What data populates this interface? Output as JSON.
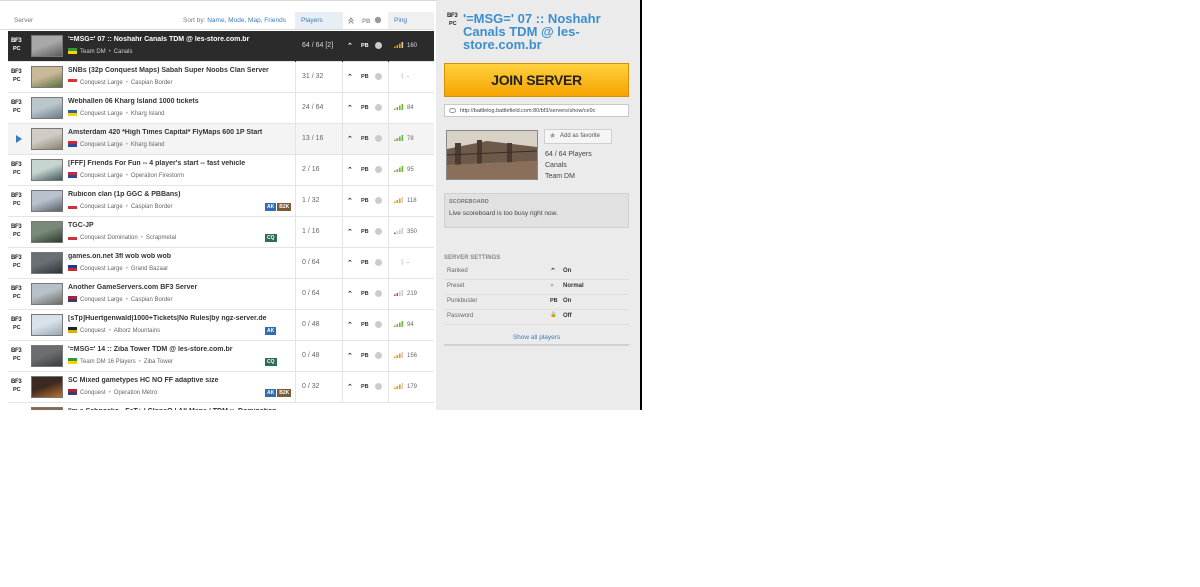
{
  "list_header": {
    "server": "Server",
    "sort_label": "Sort by:",
    "sort_options": "Name, Mode, Map, Friends",
    "players": "Players",
    "pb": "PB",
    "ping": "Ping"
  },
  "platform": {
    "top": "BF3",
    "bottom": "PC"
  },
  "servers": [
    {
      "name": "'=MSG=' 07 :: Noshahr Canals TDM @ les-store.com.br",
      "mode": "Team DM",
      "map": "Canals",
      "players": "64 / 64 [2]",
      "ping": "160",
      "flag": "br",
      "badges": [],
      "selected": true
    },
    {
      "name": "SNBs (32p Conquest Maps) Sabah Super Noobs Clan Server",
      "mode": "Conquest Large",
      "map": "Caspian Border",
      "players": "31 / 32",
      "ping": "-",
      "flag": "sg",
      "badges": []
    },
    {
      "name": "Webhallen 06 Kharg Island 1000 tickets",
      "mode": "Conquest Large",
      "map": "Kharg Island",
      "players": "24 / 64",
      "ping": "84",
      "flag": "se",
      "badges": []
    },
    {
      "name": "Amsterdam 420 *High Times Capital* FlyMaps 600 1P Start",
      "mode": "Conquest Large",
      "map": "Kharg Island",
      "players": "13 / 16",
      "ping": "78",
      "flag": "nl",
      "badges": [],
      "playing": true
    },
    {
      "name": "[FFF] Friends For Fun -- 4 player's start -- fast vehicle",
      "mode": "Conquest Large",
      "map": "Operation Firestorm",
      "players": "2 / 16",
      "ping": "95",
      "flag": "nl",
      "badges": []
    },
    {
      "name": "Rubicon clan (1p GGC & PBBans)",
      "mode": "Conquest Large",
      "map": "Caspian Border",
      "players": "1 / 32",
      "ping": "118",
      "flag": "ru",
      "badges": [
        "AK",
        "B2K"
      ]
    },
    {
      "name": "TGC-JP",
      "mode": "Conquest Domination",
      "map": "Scrapmetal",
      "players": "1 / 16",
      "ping": "350",
      "flag": "jp",
      "badges": [
        "CQ"
      ]
    },
    {
      "name": "games.on.net 3fl wob wob wob",
      "mode": "Conquest Large",
      "map": "Grand Bazaar",
      "players": "0 / 64",
      "ping": "-",
      "flag": "au",
      "badges": []
    },
    {
      "name": "Another GameServers.com BF3 Server",
      "mode": "Conquest Large",
      "map": "Caspian Border",
      "players": "0 / 64",
      "ping": "219",
      "flag": "us",
      "badges": []
    },
    {
      "name": "[sTp]Huertgenwald|1000+Tickets|No Rules|by ngz-server.de",
      "mode": "Conquest",
      "map": "Alborz Mountains",
      "players": "0 / 48",
      "ping": "94",
      "flag": "de",
      "badges": [
        "AK"
      ]
    },
    {
      "name": "'=MSG=' 14 :: Ziba Tower TDM @ les-store.com.br",
      "mode": "Team DM 16 Players",
      "map": "Ziba Tower",
      "players": "0 / 48",
      "ping": "156",
      "flag": "br",
      "badges": [
        "CQ"
      ]
    },
    {
      "name": "SC Mixed gametypes HC NO FF adaptive size",
      "mode": "Conquest",
      "map": "Operation Métro",
      "players": "0 / 32",
      "ping": "179",
      "flag": "us",
      "badges": [
        "AK",
        "B2K"
      ]
    },
    {
      "name": "I'm a Schnocko - FaT+ | CloneO | All Maps / TDM u. Domination",
      "mode": "",
      "map": "",
      "players": "",
      "ping": "",
      "flag": "de",
      "badges": []
    }
  ],
  "detail": {
    "title": "'=MSG=' 07 :: Noshahr Canals TDM @ les-store.com.br",
    "join_label": "JOIN SERVER",
    "url": "http://battlelog.battlefield.com:80/bf3/servers/show/ce9c",
    "favorite_label": "Add as favorite",
    "players": "64 / 64 Players",
    "map": "Canals",
    "mode": "Team DM",
    "scoreboard_title": "SCOREBOARD",
    "scoreboard_text": "Live scoreboard is too busy right now.",
    "settings_title": "SERVER SETTINGS",
    "settings": [
      {
        "label": "Ranked",
        "value": "On",
        "icon": "rank-icon"
      },
      {
        "label": "Preset",
        "value": "Normal",
        "icon": "preset-icon"
      },
      {
        "label": "Punkbuster",
        "value": "On",
        "icon": "pb-icon"
      },
      {
        "label": "Password",
        "value": "Off",
        "icon": "lock-icon"
      }
    ],
    "show_all": "Show all players"
  },
  "colors": {
    "accent_blue": "#3b8fd0",
    "join_yellow": "#ffc21f",
    "selected_row": "#2b2b2b"
  }
}
